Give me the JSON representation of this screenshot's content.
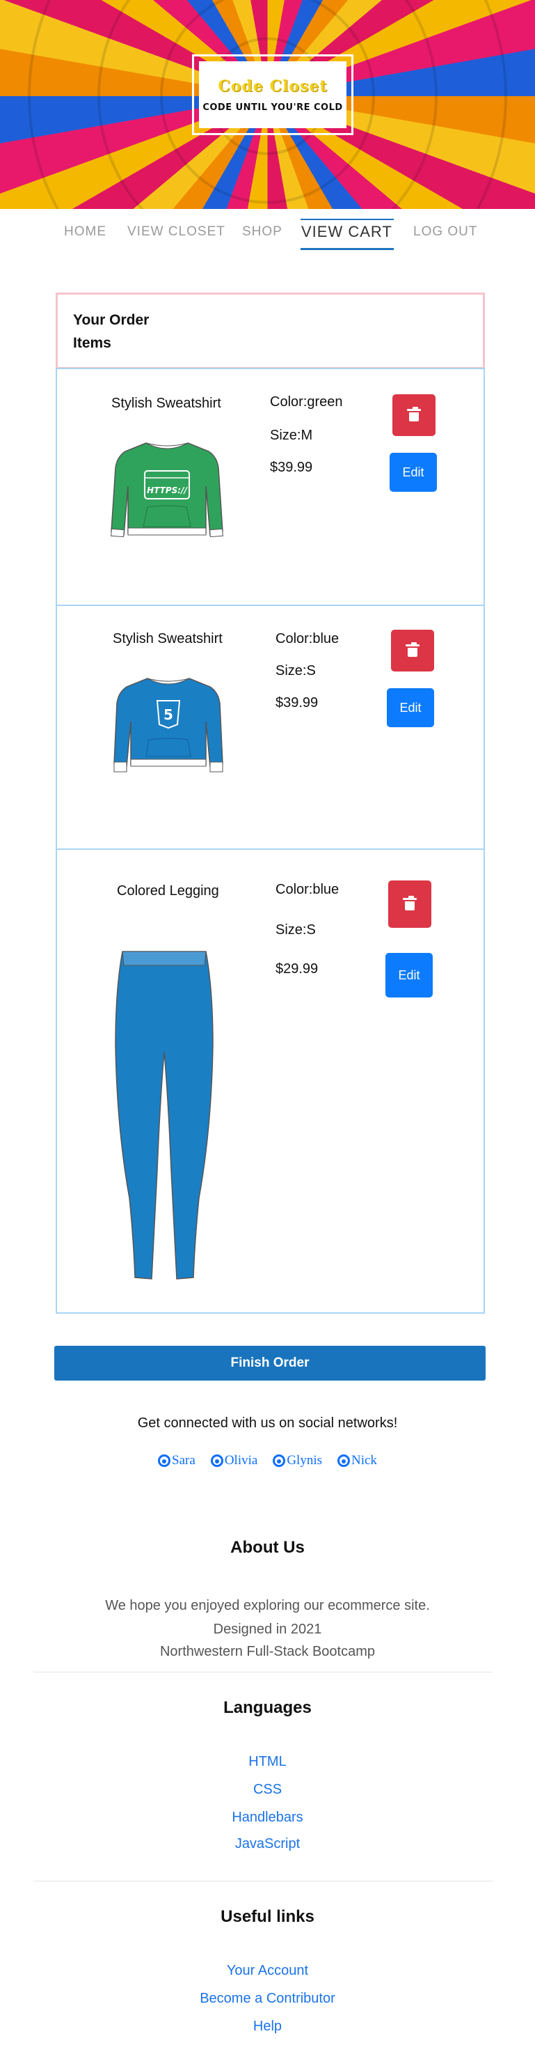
{
  "brand": {
    "title": "Code Closet",
    "tagline": "CODE UNTIL YOU'RE COLD"
  },
  "nav": {
    "items": [
      {
        "label": "HOME"
      },
      {
        "label": "VIEW CLOSET"
      },
      {
        "label": "SHOP"
      },
      {
        "label": "VIEW CART",
        "active": true
      },
      {
        "label": "LOG OUT"
      }
    ]
  },
  "order": {
    "title": "Your Order",
    "subtitle": "Items"
  },
  "items": [
    {
      "name": "Stylish Sweatshirt",
      "color_label": "Color:green",
      "size_label": "Size:M",
      "price": "$39.99",
      "edit_label": "Edit",
      "garment_color": "#2fa35b",
      "garment_print": "HTTPS://"
    },
    {
      "name": "Stylish Sweatshirt",
      "color_label": "Color:blue",
      "size_label": "Size:S",
      "price": "$39.99",
      "edit_label": "Edit",
      "garment_color": "#1b7fc4",
      "garment_print": "5"
    },
    {
      "name": "Colored Legging",
      "color_label": "Color:blue",
      "size_label": "Size:S",
      "price": "$29.99",
      "edit_label": "Edit",
      "garment_color": "#1b7fc4"
    }
  ],
  "finish_label": "Finish Order",
  "social": {
    "title": "Get connected with us on social networks!",
    "links": [
      "Sara",
      "Olivia",
      "Glynis",
      "Nick"
    ]
  },
  "about": {
    "title": "About Us",
    "lines": [
      "We hope you enjoyed exploring our ecommerce site.",
      "Designed in 2021",
      "Northwestern Full-Stack Bootcamp"
    ]
  },
  "languages": {
    "title": "Languages",
    "links": [
      "HTML",
      "CSS",
      "Handlebars",
      "JavaScript"
    ]
  },
  "useful": {
    "title": "Useful links",
    "links": [
      "Your Account",
      "Become a Contributor",
      "Help"
    ]
  },
  "colors": {
    "danger": "#dc3545",
    "primary": "#0d7bfd",
    "finish": "#1a74bd",
    "link": "#1a73e8",
    "brand_yellow": "#f3d01d"
  }
}
